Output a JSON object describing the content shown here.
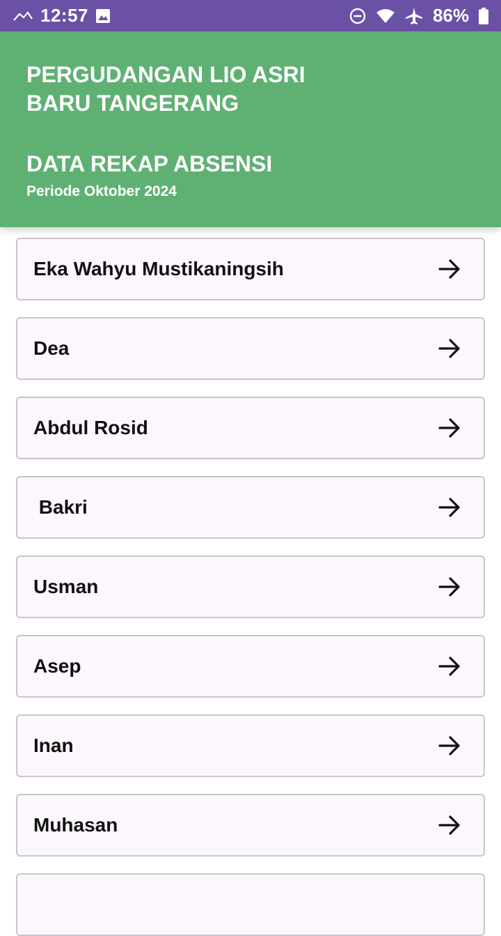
{
  "status_bar": {
    "time": "12:57",
    "battery": "86%",
    "icons": [
      "signal-icon",
      "image-icon",
      "do-not-disturb-icon",
      "wifi-icon",
      "airplane-icon",
      "battery-icon"
    ]
  },
  "header": {
    "title": "PERGUDANGAN LIO ASRI\nBARU TANGERANG",
    "subtitle": "DATA REKAP ABSENSI",
    "period": "Periode Oktober 2024",
    "color": "#5fb173"
  },
  "employees": [
    {
      "name": "Eka Wahyu Mustikaningsih"
    },
    {
      "name": "Dea"
    },
    {
      "name": "Abdul Rosid"
    },
    {
      "name": " Bakri"
    },
    {
      "name": "Usman"
    },
    {
      "name": "Asep"
    },
    {
      "name": "Inan"
    },
    {
      "name": "Muhasan"
    },
    {
      "name": ""
    }
  ],
  "colors": {
    "status_bar": "#6a51a6",
    "card_bg": "#fcf6fd",
    "card_border": "#c9c4cf"
  }
}
